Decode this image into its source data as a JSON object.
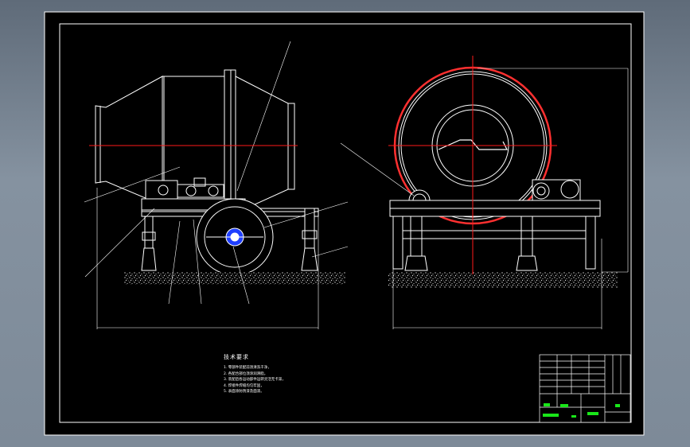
{
  "notes": {
    "title": "技术要求",
    "lines": [
      "1. 零部件装配前须清洗干净，",
      "2. 各配合部位须涂润滑脂，",
      "3. 装配后各运动部件运转灵活无卡滞，",
      "4. 焊接件焊缝均匀牢固，",
      "5. 表面涂防锈漆及面漆。"
    ]
  },
  "title_block": {
    "cells": [
      "",
      "",
      "",
      "",
      ""
    ]
  },
  "colors": {
    "background": "#000000",
    "frame": "#ffffff",
    "centerline": "#ff1a1a",
    "ground_hatch": "#c8c8c8",
    "title_block_green": "#19e619"
  },
  "icons": [
    "mixer-side-view",
    "mixer-front-view",
    "title-block"
  ]
}
